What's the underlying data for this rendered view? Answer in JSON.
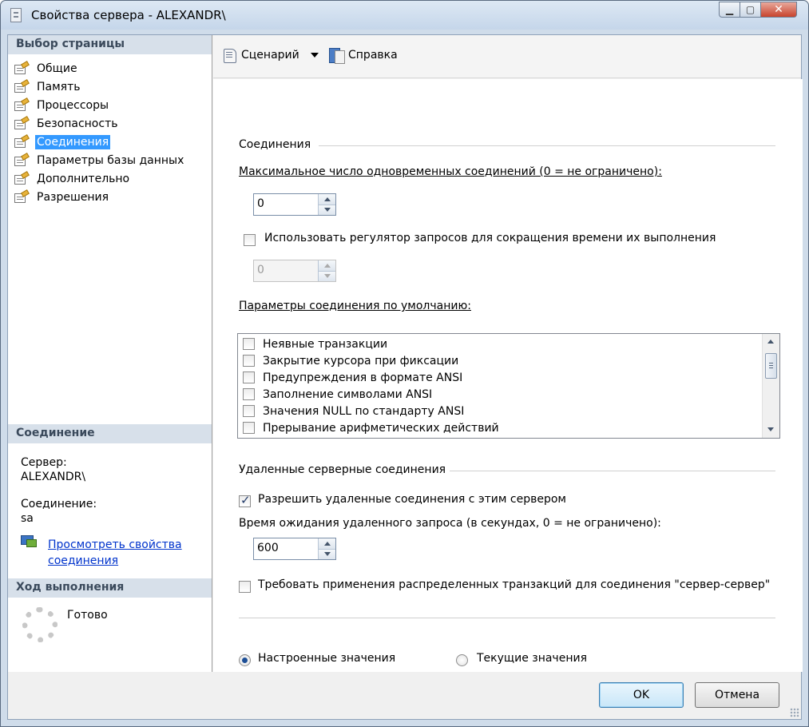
{
  "window": {
    "title": "Свойства сервера - ALEXANDR\\",
    "controls": [
      "minimize-icon",
      "maximize-icon",
      "close-icon"
    ]
  },
  "left": {
    "select_page_header": "Выбор страницы",
    "pages": [
      {
        "label": "Общие",
        "selected": false
      },
      {
        "label": "Память",
        "selected": false
      },
      {
        "label": "Процессоры",
        "selected": false
      },
      {
        "label": "Безопасность",
        "selected": false
      },
      {
        "label": "Соединения",
        "selected": true
      },
      {
        "label": "Параметры базы данных",
        "selected": false
      },
      {
        "label": "Дополнительно",
        "selected": false
      },
      {
        "label": "Разрешения",
        "selected": false
      }
    ],
    "connection_header": "Соединение",
    "server_label": "Сервер:",
    "server_value": "ALEXANDR\\",
    "connection_label": "Соединение:",
    "connection_value": "sa",
    "view_props_link_line1": "Просмотреть свойства",
    "view_props_link_line2": "соединения",
    "progress_header": "Ход выполнения",
    "progress_status": "Готово"
  },
  "toolbar": {
    "script_label": "Сценарий",
    "help_label": "Справка"
  },
  "main": {
    "connections_group": "Соединения",
    "max_connections_label": "Максимальное число одновременных соединений (0 = не ограничено):",
    "max_connections_value": "0",
    "use_query_governor_label": "Использовать регулятор запросов для сокращения времени их выполнения",
    "use_query_governor_checked": false,
    "query_governor_value": "0",
    "default_options_label": "Параметры соединения по умолчанию:",
    "default_options": [
      {
        "label": "Неявные транзакции",
        "checked": false
      },
      {
        "label": "Закрытие курсора при фиксации",
        "checked": false
      },
      {
        "label": "Предупреждения в формате ANSI",
        "checked": false
      },
      {
        "label": "Заполнение символами ANSI",
        "checked": false
      },
      {
        "label": "Значения NULL по стандарту ANSI",
        "checked": false
      },
      {
        "label": "Прерывание арифметических действий",
        "checked": false
      }
    ],
    "remote_group": "Удаленные серверные соединения",
    "allow_remote_label": "Разрешить удаленные соединения с этим сервером",
    "allow_remote_checked": true,
    "remote_timeout_label": "Время ожидания удаленного запроса (в секундах, 0 = не ограничено):",
    "remote_timeout_value": "600",
    "require_distributed_label": "Требовать применения распределенных транзакций для соединения \"сервер-сервер\"",
    "require_distributed_checked": false,
    "radio_configured_label": "Настроенные значения",
    "radio_running_label": "Текущие значения",
    "radio_selected": "configured"
  },
  "buttons": {
    "ok": "OK",
    "cancel": "Отмена"
  }
}
